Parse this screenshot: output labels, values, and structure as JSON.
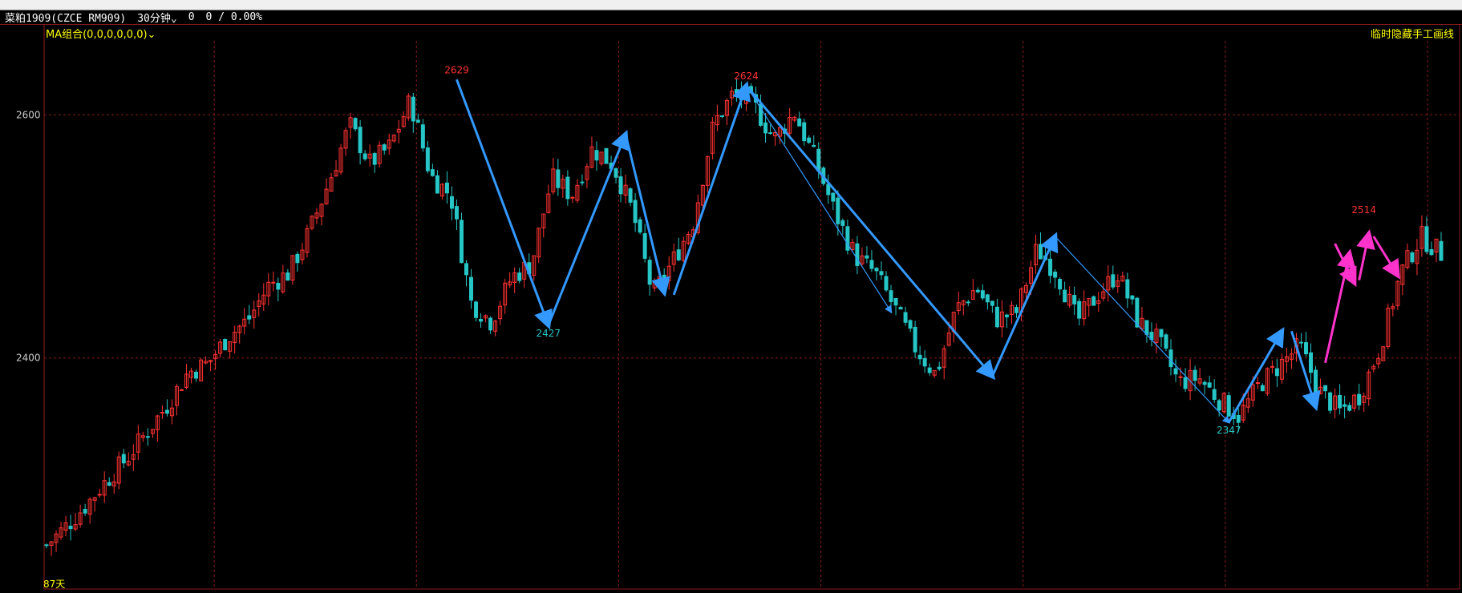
{
  "header": {
    "symbol": "菜粕1909(CZCE RM909)",
    "period": "30分钟",
    "value1": "0",
    "value2": "0 / 0.00%"
  },
  "overlay": {
    "ma_label": "MA组合(0,0,0,0,0,0)",
    "hide_lines_label": "临时隐藏手工画线",
    "days_label": "87天"
  },
  "colors": {
    "background": "#000000",
    "grid": "#8b1a1a",
    "candle_up": "#ff3232",
    "candle_down": "#26c6c6",
    "drawn_line": "#3399ff",
    "drawn_line_pink": "#ff33cc",
    "label_red": "#ff3232",
    "label_cyan": "#26c6c6"
  },
  "chart_data": {
    "type": "candlestick",
    "ylim": [
      2210,
      2674
    ],
    "y_ticks": [
      2400,
      2600
    ],
    "grid": true,
    "price_anchors": [
      2246,
      2262,
      2280,
      2300,
      2318,
      2340,
      2362,
      2388,
      2396,
      2418,
      2432,
      2460,
      2470,
      2504,
      2546,
      2592,
      2560,
      2574,
      2612,
      2550,
      2534,
      2446,
      2430,
      2466,
      2478,
      2548,
      2534,
      2572,
      2560,
      2520,
      2452,
      2480,
      2512,
      2592,
      2618,
      2608,
      2580,
      2602,
      2564,
      2520,
      2484,
      2470,
      2440,
      2408,
      2386,
      2440,
      2458,
      2432,
      2438,
      2490,
      2470,
      2430,
      2452,
      2470,
      2430,
      2414,
      2380,
      2384,
      2366,
      2352,
      2378,
      2394,
      2410,
      2372,
      2356,
      2370,
      2410,
      2470,
      2500,
      2486
    ],
    "annotations": [
      {
        "text": "2629",
        "x_index": 85,
        "price": 2629,
        "color": "red"
      },
      {
        "text": "2427",
        "x_index": 104,
        "price": 2427,
        "color": "cyan"
      },
      {
        "text": "2624",
        "x_index": 145,
        "price": 2624,
        "color": "red"
      },
      {
        "text": "2347",
        "x_index": 245,
        "price": 2347,
        "color": "cyan"
      },
      {
        "text": "2514",
        "x_index": 273,
        "price": 2514,
        "color": "red"
      }
    ],
    "drawn_lines": [
      {
        "from": [
          85,
          2629
        ],
        "to": [
          104,
          2427
        ],
        "arrow": true,
        "thin": false
      },
      {
        "from": [
          104,
          2427
        ],
        "to": [
          120,
          2584
        ],
        "arrow": true,
        "thin": false
      },
      {
        "from": [
          120,
          2584
        ],
        "to": [
          128,
          2454
        ],
        "arrow": true,
        "thin": false
      },
      {
        "from": [
          130,
          2452
        ],
        "to": [
          145,
          2624
        ],
        "arrow": true,
        "thin": false
      },
      {
        "from": [
          145,
          2624
        ],
        "to": [
          175,
          2438
        ],
        "arrow": true,
        "thin": true
      },
      {
        "from": [
          145,
          2624
        ],
        "to": [
          196,
          2385
        ],
        "arrow": true,
        "thin": false
      },
      {
        "from": [
          196,
          2385
        ],
        "to": [
          209,
          2500
        ],
        "arrow": true,
        "thin": false
      },
      {
        "from": [
          209,
          2500
        ],
        "to": [
          245,
          2347
        ],
        "arrow": true,
        "thin": true
      },
      {
        "from": [
          245,
          2347
        ],
        "to": [
          256,
          2422
        ],
        "arrow": true,
        "thin": false
      },
      {
        "from": [
          258,
          2422
        ],
        "to": [
          263,
          2360
        ],
        "arrow": true,
        "thin": false
      },
      {
        "from": [
          265,
          2396
        ],
        "to": [
          270,
          2486
        ],
        "arrow": true,
        "pink": true
      },
      {
        "from": [
          267,
          2494
        ],
        "to": [
          271,
          2462
        ],
        "arrow": true,
        "pink": true
      },
      {
        "from": [
          272,
          2464
        ],
        "to": [
          274,
          2502
        ],
        "arrow": true,
        "pink": true
      },
      {
        "from": [
          275,
          2500
        ],
        "to": [
          280,
          2468
        ],
        "arrow": true,
        "pink": true
      }
    ]
  }
}
